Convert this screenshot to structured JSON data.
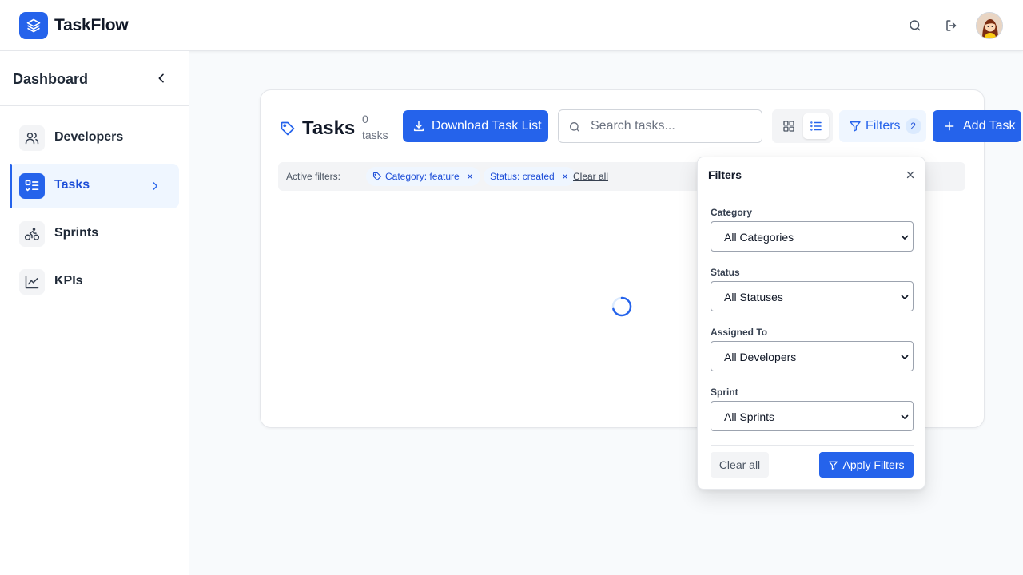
{
  "app": {
    "name": "TaskFlow"
  },
  "header": {
    "icons": [
      "layers-icon",
      "search-icon",
      "logout-icon",
      "avatar"
    ]
  },
  "sidebar": {
    "title": "Dashboard",
    "items": [
      {
        "label": "Developers",
        "icon": "users-icon",
        "active": false
      },
      {
        "label": "Tasks",
        "icon": "list-check-icon",
        "active": true
      },
      {
        "label": "Sprints",
        "icon": "bike-icon",
        "active": false
      },
      {
        "label": "KPIs",
        "icon": "line-chart-icon",
        "active": false
      }
    ]
  },
  "main": {
    "title": "Tasks",
    "count": "0",
    "count_unit": "tasks",
    "download_label": "Download Task List",
    "search_placeholder": "Search tasks...",
    "filters_label": "Filters",
    "filters_count": "2",
    "add_label": "Add Task",
    "active_filters_label": "Active filters:",
    "chips": [
      "Category: feature",
      "Status: created"
    ],
    "clear_all_label": "Clear all"
  },
  "filters_panel": {
    "title": "Filters",
    "fields": [
      {
        "label": "Category",
        "value": "All Categories"
      },
      {
        "label": "Status",
        "value": "All Statuses"
      },
      {
        "label": "Assigned To",
        "value": "All Developers"
      },
      {
        "label": "Sprint",
        "value": "All Sprints"
      }
    ],
    "clear_label": "Clear all",
    "apply_label": "Apply Filters"
  },
  "colors": {
    "primary": "#2563eb",
    "primary_light": "#eff6ff",
    "border": "#e5e7eb",
    "text": "#111827"
  }
}
